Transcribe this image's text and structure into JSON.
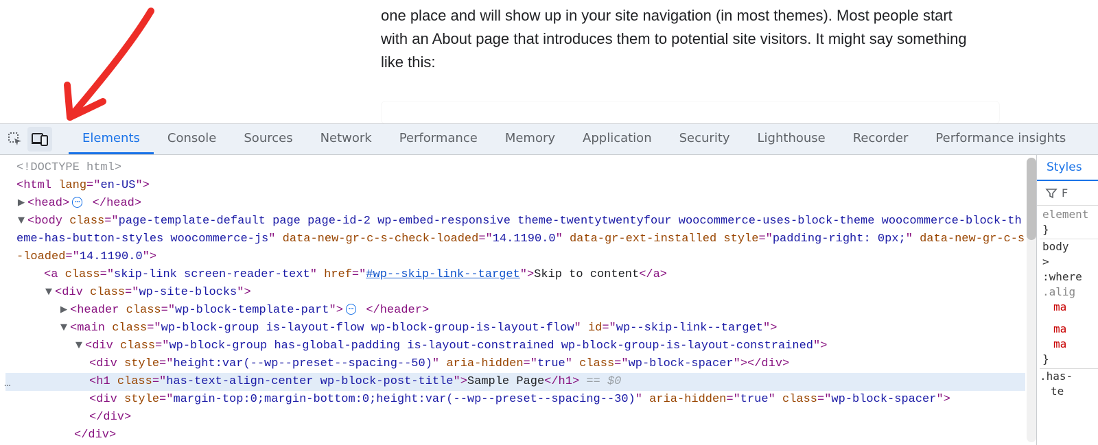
{
  "pageText": "one place and will show up in your site navigation (in most themes). Most people start with an About page that introduces them to potential site visitors. It might say something like this:",
  "tabs": [
    "Elements",
    "Console",
    "Sources",
    "Network",
    "Performance",
    "Memory",
    "Application",
    "Security",
    "Lighthouse",
    "Recorder",
    "Performance insights"
  ],
  "activeTab": "Elements",
  "stylesTab": "Styles",
  "stylesFilterIcon": "▾",
  "stylesRules": {
    "inlineLabel": "element",
    "braceClose": "}",
    "bodySel": "body",
    "caret": ">",
    "whereStart": ":where",
    "alignCut": ".alig",
    "maCut": "ma",
    "hasCut": ".has-",
    "teCut": "te"
  },
  "ellipsisBadge": "⋯",
  "dom": {
    "doctype": "<!DOCTYPE html>",
    "html_open": {
      "tag": "html",
      "attrs": [
        [
          "lang",
          "en-US"
        ]
      ]
    },
    "head": {
      "tag": "head"
    },
    "body": {
      "tag": "body",
      "classVal": "page-template-default page page-id-2 wp-embed-responsive theme-twentytwentyfour woocommerce-uses-block-theme woocommerce-block-theme-has-button-styles woocommerce-js",
      "attrs2": [
        [
          "data-new-gr-c-s-check-loaded",
          "14.1190.0"
        ],
        [
          "data-gr-ext-installed",
          ""
        ]
      ],
      "styleVal": "padding-right: 0px;",
      "attrs3": [
        [
          "data-new-gr-c-s-loaded",
          "14.1190.0"
        ]
      ]
    },
    "skip": {
      "tag": "a",
      "classVal": "skip-link screen-reader-text",
      "href": "#wp--skip-link--target",
      "text": "Skip to content"
    },
    "siteblocks": {
      "tag": "div",
      "classVal": "wp-site-blocks"
    },
    "header": {
      "tag": "header",
      "classVal": "wp-block-template-part"
    },
    "main": {
      "tag": "main",
      "classVal": "wp-block-group is-layout-flow wp-block-group-is-layout-flow",
      "id": "wp--skip-link--target"
    },
    "group": {
      "tag": "div",
      "classVal": "wp-block-group has-global-padding is-layout-constrained wp-block-group-is-layout-constrained"
    },
    "spacer1": {
      "tag": "div",
      "styleVal": "height:var(--wp--preset--spacing--50)",
      "aria": "true",
      "classVal": "wp-block-spacer"
    },
    "h1": {
      "tag": "h1",
      "classVal": "has-text-align-center wp-block-post-title",
      "text": "Sample Page",
      "cursor": "== $0"
    },
    "spacer2": {
      "tag": "div",
      "styleVal": "margin-top:0;margin-bottom:0;height:var(--wp--preset--spacing--30)",
      "aria": "true",
      "classVal": "wp-block-spacer"
    },
    "close1": "</div>",
    "close2": "</div>"
  },
  "twisty": {
    "right": "▶",
    "down": "▼"
  }
}
